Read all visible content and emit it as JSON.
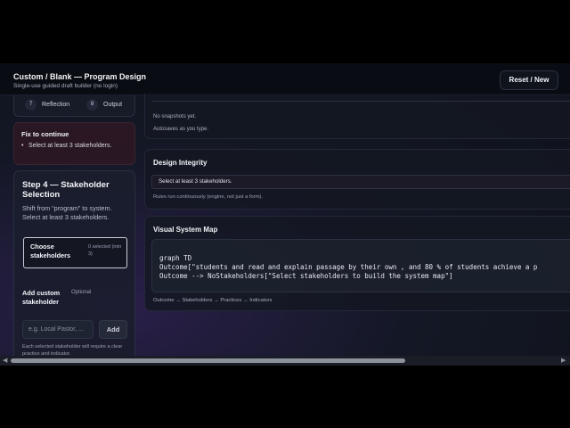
{
  "header": {
    "title": "Custom / Blank — Program Design",
    "subtitle": "Single-use guided draft builder (no login)",
    "reset_label": "Reset / New"
  },
  "steps": [
    {
      "num": "7",
      "label": "Reflection"
    },
    {
      "num": "8",
      "label": "Output"
    }
  ],
  "fix": {
    "title": "Fix to continue",
    "items": [
      "Select at least 3 stakeholders."
    ]
  },
  "step4": {
    "title": "Step 4 — Stakeholder Selection",
    "description": "Shift from “program” to system. Select at least 3 stakeholders.",
    "choose_label": "Choose stakeholders",
    "choose_count": "0 selected (min 3)",
    "add_label": "Add custom stakeholder",
    "optional": "Optional",
    "input_placeholder": "e.g. Local Pastor, ...",
    "add_button": "Add",
    "help_note": "Each selected stakeholder will require a clear practice and indicator."
  },
  "snapshots": {
    "empty": "No snapshots yet.",
    "autosave": "Autosaves as you type."
  },
  "integrity": {
    "title": "Design Integrity",
    "message": "Select at least 3 stakeholders.",
    "note": "Rules run continuously (engine, not just a form)."
  },
  "system_map": {
    "title": "Visual System Map",
    "code": [
      "graph TD",
      "Outcome[\"students and read and explain passage by their own , and 80 % of students achieve a p",
      "Outcome --> NoStakeholders[\"Select stakeholders to build the system map\"]"
    ],
    "flow": "Outcome → Stakeholders → Practices → Indicators"
  }
}
